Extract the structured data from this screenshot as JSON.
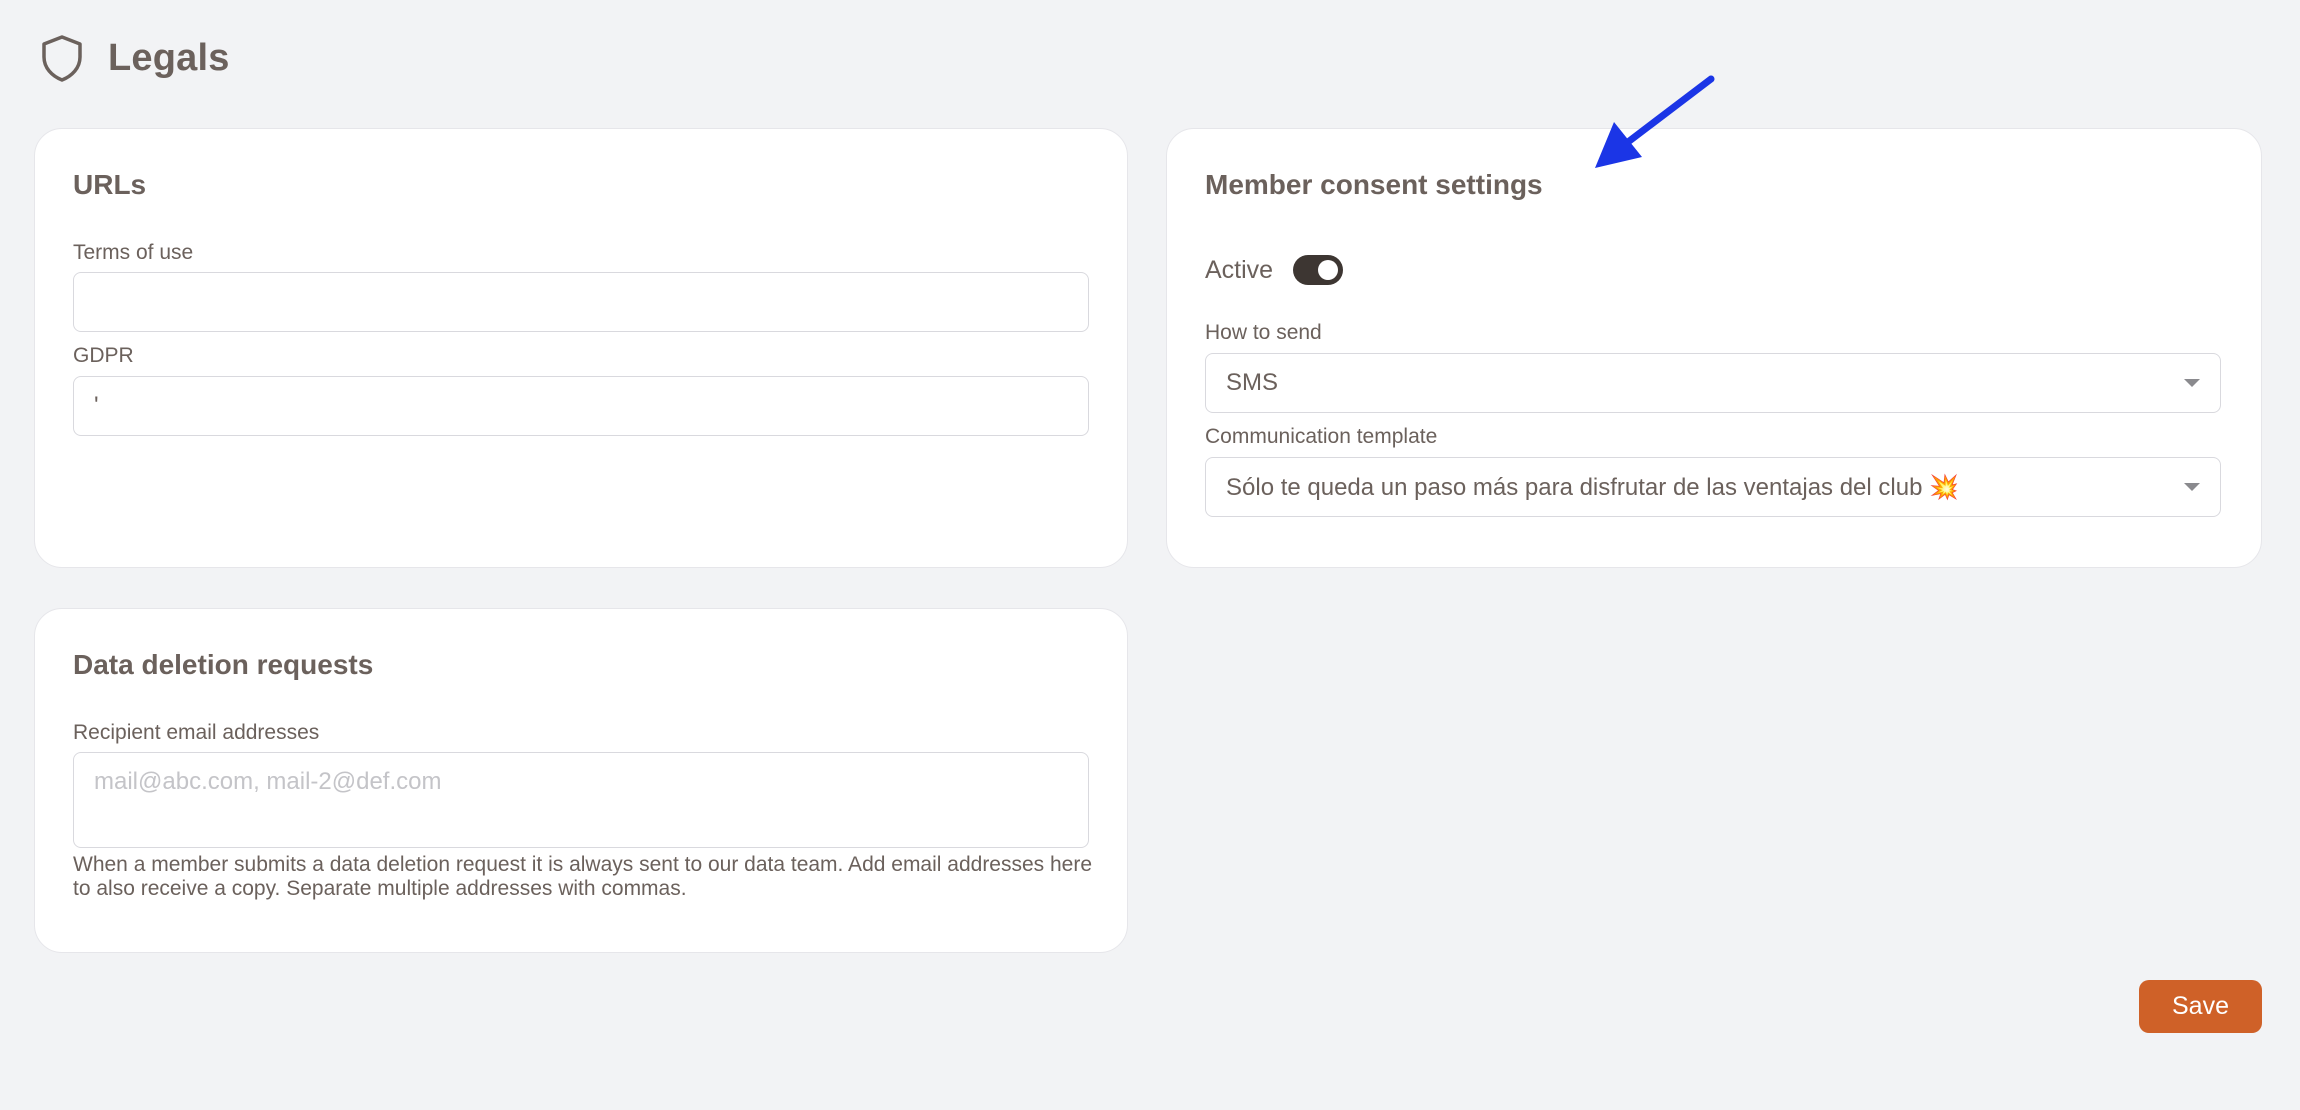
{
  "header": {
    "icon": "shield-icon",
    "title": "Legals"
  },
  "urls_card": {
    "title": "URLs",
    "terms_label": "Terms of use",
    "terms_value": "",
    "gdpr_label": "GDPR",
    "gdpr_value": "'"
  },
  "consent_card": {
    "title": "Member consent settings",
    "active_label": "Active",
    "active_on": true,
    "how_to_send_label": "How to send",
    "how_to_send_value": "SMS",
    "template_label": "Communication template",
    "template_value": "Sólo te queda un paso más para disfrutar de las ventajas del club 💥"
  },
  "deletion_card": {
    "title": "Data deletion requests",
    "recipients_label": "Recipient email addresses",
    "recipients_placeholder": "mail@abc.com, mail-2@def.com",
    "help": "When a member submits a data deletion request it is always sent to our data team. Add email addresses here to also receive a copy. Separate multiple addresses with commas."
  },
  "actions": {
    "save_label": "Save"
  },
  "colors": {
    "accent": "#cf6128",
    "annotation_arrow": "#1b35e6",
    "toggle_on": "#3d3632"
  }
}
